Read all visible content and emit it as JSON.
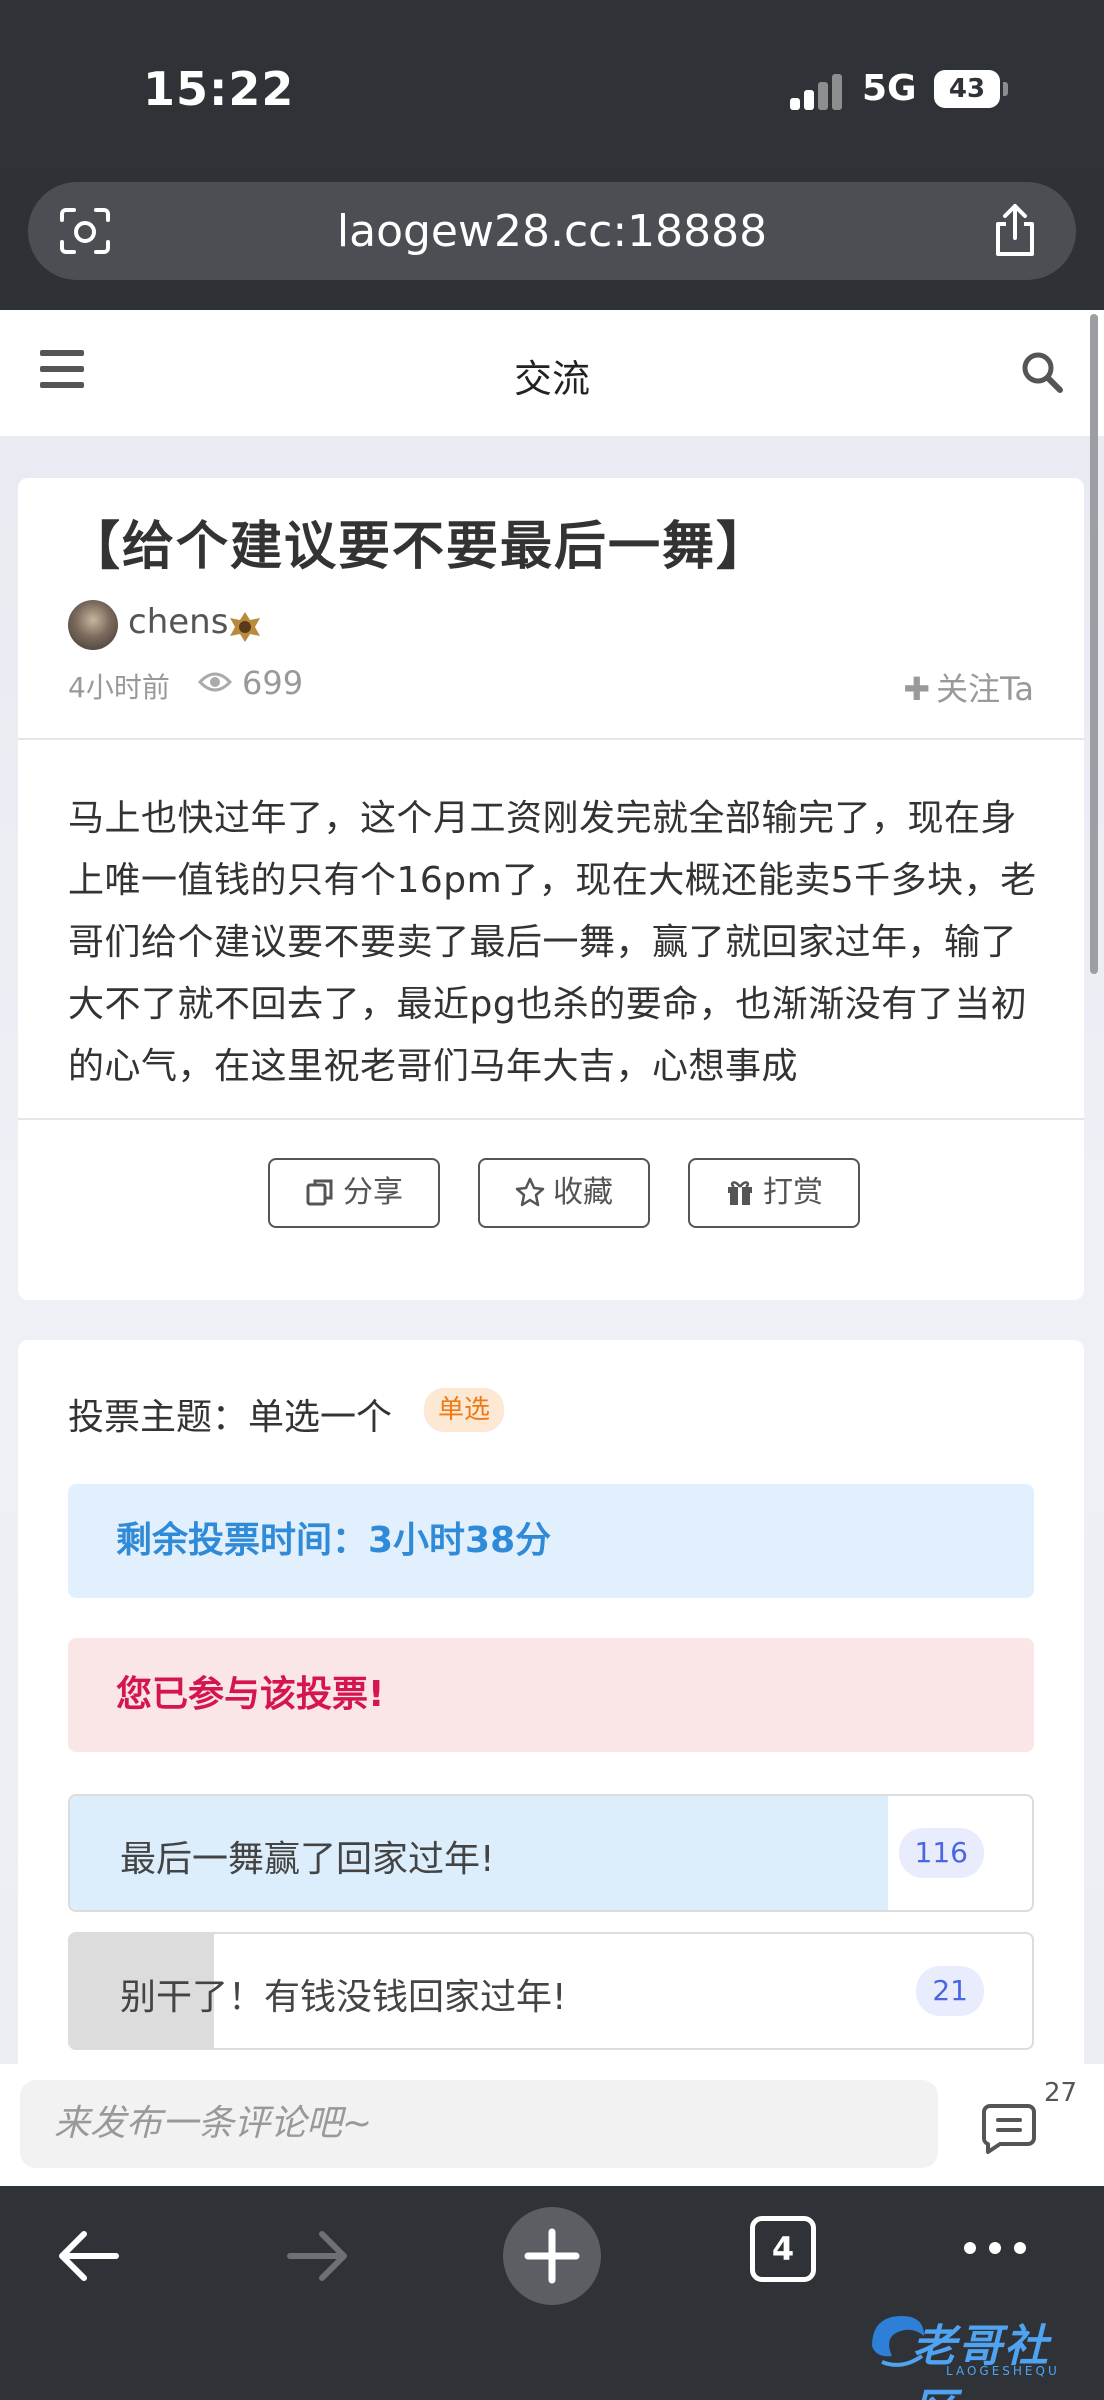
{
  "status": {
    "time": "15:22",
    "network": "5G",
    "battery": "43"
  },
  "browser": {
    "url": "laogew28.cc:18888",
    "tab_count": "4"
  },
  "header": {
    "title": "交流"
  },
  "post": {
    "title": "【给个建议要不要最后一舞】",
    "author": "chens",
    "time_ago": "4小时前",
    "views": "699",
    "follow_label": "关注Ta",
    "body": "马上也快过年了，这个月工资刚发完就全部输完了，现在身上唯一值钱的只有个16pm了，现在大概还能卖5千多块，老哥们给个建议要不要卖了最后一舞，赢了就回家过年，输了大不了就不回去了，最近pg也杀的要命，也渐渐没有了当初的心气，在这里祝老哥们马年大吉，心想事成",
    "actions": {
      "share": "分享",
      "favorite": "收藏",
      "reward": "打赏"
    }
  },
  "poll": {
    "topic": "投票主题：单选一个",
    "type_tag": "单选",
    "remaining": "剩余投票时间：3小时38分",
    "participated": "您已参与该投票!",
    "options": [
      {
        "label": "最后一舞赢了回家过年!",
        "count": "116",
        "share": 0.85,
        "color": "#dceefb"
      },
      {
        "label": "别干了！有钱没钱回家过年!",
        "count": "21",
        "share": 0.15,
        "color": "#dcdcdc"
      }
    ]
  },
  "comment": {
    "placeholder": "来发布一条评论吧~",
    "count": "27"
  },
  "watermark": {
    "text": "老哥社区",
    "sub": "LAOGESHEQU"
  }
}
